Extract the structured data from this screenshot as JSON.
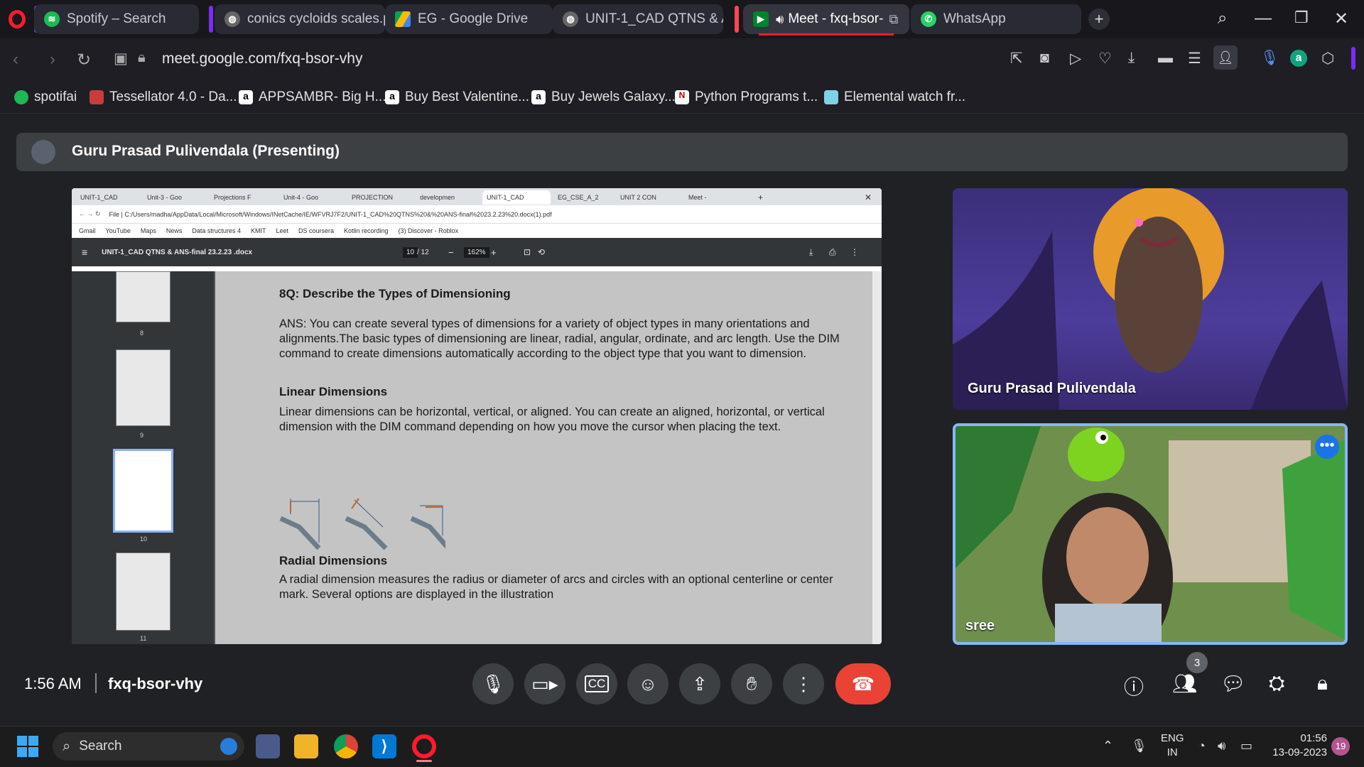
{
  "tabs": [
    {
      "label": "Spotify – Search",
      "icon": "spotify-icon"
    },
    {
      "label": "conics cycloids scales.pc",
      "icon": "globe-icon"
    },
    {
      "label": "EG - Google Drive",
      "icon": "drive-icon"
    },
    {
      "label": "UNIT-1_CAD QTNS & A",
      "icon": "globe-icon"
    },
    {
      "label": "Meet - fxq-bsor-",
      "icon": "meet-icon"
    },
    {
      "label": "WhatsApp",
      "icon": "whatsapp-icon"
    }
  ],
  "address": {
    "url": "meet.google.com/fxq-bsor-vhy"
  },
  "bookmarks": [
    {
      "label": "spotifai"
    },
    {
      "label": "Tessellator 4.0 - Da..."
    },
    {
      "label": "APPSAMBR- Big H..."
    },
    {
      "label": "Buy Best Valentine..."
    },
    {
      "label": "Buy Jewels Galaxy..."
    },
    {
      "label": "Python Programs t..."
    },
    {
      "label": "Elemental watch fr..."
    }
  ],
  "meet": {
    "presenter_label": "Guru Prasad Pulivendala (Presenting)",
    "time": "1:56 AM",
    "meeting_code": "fxq-bsor-vhy",
    "participant_count": "3",
    "tiles": [
      {
        "name": "Guru Prasad Pulivendala"
      },
      {
        "name": "sree"
      }
    ]
  },
  "shared": {
    "inner_tabs": [
      "UNIT-1_CAD",
      "Unit-3 - Goo",
      "Projections F",
      "Unit-4 - Goo",
      "PROJECTION",
      "developmen",
      "UNIT-1_CAD",
      "EG_CSE_A_2",
      "UNIT 2 CON",
      "Meet - "
    ],
    "inner_url": "File | C:/Users/madha/AppData/Local/Microsoft/Windows/INetCache/IE/WFVRJ7F2/UNIT-1_CAD%20QTNS%20&%20ANS-final%2023.2.23%20.docx(1).pdf",
    "inner_bookmarks": [
      "Gmail",
      "YouTube",
      "Maps",
      "News",
      "Data structures 4",
      "KMIT",
      "Leet",
      "DS coursera",
      "Kotlin recording",
      "(3) Discover - Roblox"
    ],
    "pdf_title": "UNIT-1_CAD QTNS & ANS-final 23.2.23 .docx",
    "page": "10",
    "page_total": "/ 12",
    "zoom": "162%",
    "thumb_labels": [
      "8",
      "9",
      "10",
      "11"
    ],
    "q8": "8Q: Describe the Types of Dimensioning",
    "ans": "ANS: You can create several types of dimensions for a variety of object types in many orientations and alignments.The basic types of dimensioning are linear, radial, angular, ordinate, and arc length. Use the DIM command to create dimensions automatically according to the object type that you want to dimension.",
    "linear_heading": "Linear Dimensions",
    "linear_text": "Linear dimensions can be horizontal, vertical, or aligned. You can create an aligned, horizontal, or vertical dimension with the DIM command depending on how you move the cursor when placing the text.",
    "radial_heading": "Radial Dimensions",
    "radial_text": "A radial dimension measures the radius or diameter of arcs and circles with an optional centerline or center mark. Several options are displayed in the illustration"
  },
  "taskbar": {
    "search_placeholder": "Search",
    "lang": "ENG",
    "region": "IN",
    "clock_time": "01:56",
    "clock_date": "13-09-2023",
    "notif_count": "19"
  }
}
